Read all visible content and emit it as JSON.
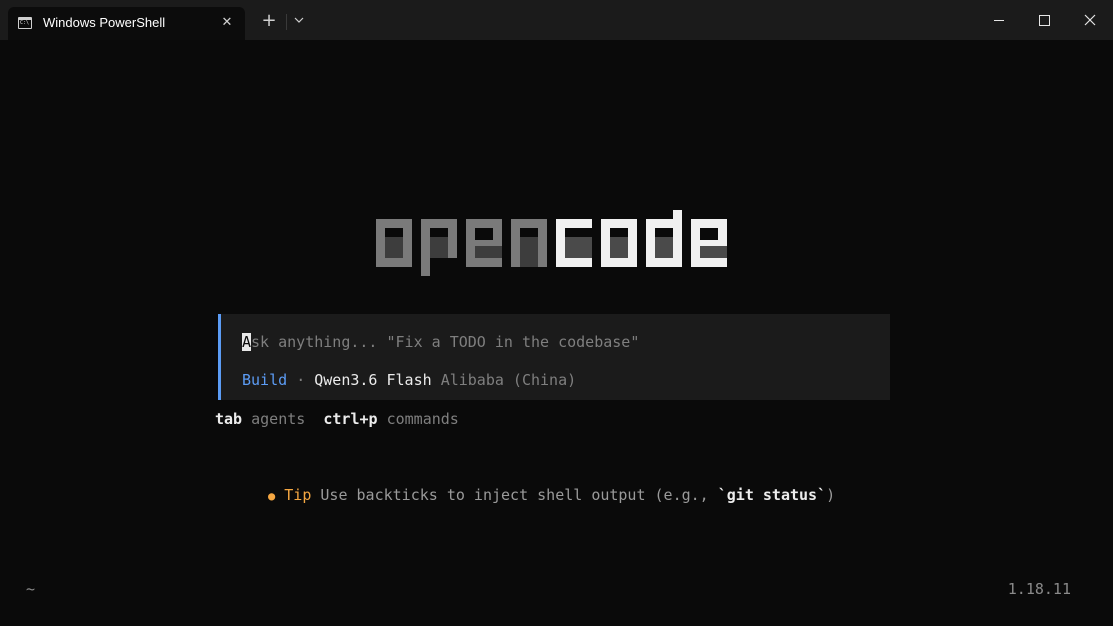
{
  "window": {
    "tab_title": "Windows PowerShell",
    "tab_icon": "terminal-icon",
    "new_tab_label": "+",
    "dropdown_label": "⌄"
  },
  "logo": {
    "text": "opencode",
    "dim_part": "open",
    "bright_part": "code"
  },
  "prompt": {
    "placeholder_first_char": "A",
    "placeholder_rest": "sk anything... \"Fix a TODO in the codebase\"",
    "agent": "Build",
    "separator": "·",
    "model": "Qwen3.6 Flash",
    "provider": "Alibaba (China)"
  },
  "hints": {
    "key1": "tab",
    "label1": "agents",
    "key2": "ctrl+p",
    "label2": "commands"
  },
  "tip": {
    "bullet": "●",
    "label": "Tip",
    "text_before": "Use backticks to inject shell output (e.g., ",
    "code": "`git status`",
    "text_after": ")"
  },
  "footer": {
    "cwd": "~",
    "version": "1.18.11"
  },
  "colors": {
    "background": "#0a0a0a",
    "accent_blue": "#5c9cf5",
    "tip_orange": "#f5a742"
  }
}
